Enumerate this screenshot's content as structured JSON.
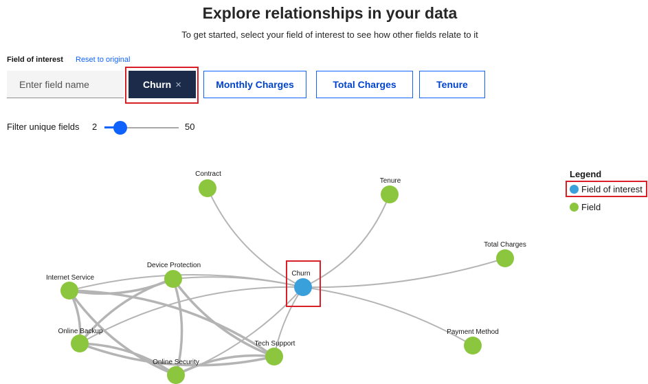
{
  "header": {
    "title": "Explore relationships in your data",
    "subtitle": "To get started, select your field of interest to see how other fields relate to it"
  },
  "field_of_interest": {
    "label": "Field of interest",
    "reset_label": "Reset to original",
    "input_placeholder": "Enter field name",
    "chips": [
      {
        "label": "Churn",
        "selected": true
      },
      {
        "label": "Monthly Charges",
        "selected": false
      },
      {
        "label": "Total Charges",
        "selected": false
      },
      {
        "label": "Tenure",
        "selected": false
      }
    ],
    "chip_close_glyph": "×"
  },
  "filter": {
    "label": "Filter unique fields",
    "min": "2",
    "max": "50",
    "value": 2
  },
  "legend": {
    "title": "Legend",
    "items": [
      {
        "label": "Field of interest",
        "color": "#3aa0dc"
      },
      {
        "label": "Field",
        "color": "#8cc63f"
      }
    ]
  },
  "graph": {
    "colors": {
      "interest": "#3aa0dc",
      "field": "#8cc63f",
      "edge": "#b4b4b4"
    },
    "nodes": [
      {
        "id": "churn",
        "label": "Churn",
        "type": "interest"
      },
      {
        "id": "contract",
        "label": "Contract",
        "type": "field"
      },
      {
        "id": "tenure",
        "label": "Tenure",
        "type": "field"
      },
      {
        "id": "total_charges",
        "label": "Total Charges",
        "type": "field"
      },
      {
        "id": "payment_method",
        "label": "Payment Method",
        "type": "field"
      },
      {
        "id": "internet_service",
        "label": "Internet Service",
        "type": "field"
      },
      {
        "id": "device_protection",
        "label": "Device Protection",
        "type": "field"
      },
      {
        "id": "online_backup",
        "label": "Online Backup",
        "type": "field"
      },
      {
        "id": "online_security",
        "label": "Online Security",
        "type": "field"
      },
      {
        "id": "tech_support",
        "label": "Tech Support",
        "type": "field"
      }
    ],
    "edges": [
      {
        "source": "churn",
        "target": "contract"
      },
      {
        "source": "churn",
        "target": "tenure"
      },
      {
        "source": "churn",
        "target": "total_charges"
      },
      {
        "source": "churn",
        "target": "payment_method"
      },
      {
        "source": "churn",
        "target": "internet_service"
      },
      {
        "source": "churn",
        "target": "device_protection"
      },
      {
        "source": "churn",
        "target": "online_backup"
      },
      {
        "source": "churn",
        "target": "online_security"
      },
      {
        "source": "churn",
        "target": "tech_support"
      },
      {
        "source": "internet_service",
        "target": "device_protection"
      },
      {
        "source": "internet_service",
        "target": "online_backup"
      },
      {
        "source": "internet_service",
        "target": "online_security"
      },
      {
        "source": "internet_service",
        "target": "tech_support"
      },
      {
        "source": "device_protection",
        "target": "online_backup"
      },
      {
        "source": "device_protection",
        "target": "online_security"
      },
      {
        "source": "device_protection",
        "target": "tech_support"
      },
      {
        "source": "online_backup",
        "target": "online_security"
      },
      {
        "source": "online_backup",
        "target": "tech_support"
      },
      {
        "source": "online_security",
        "target": "tech_support"
      }
    ]
  }
}
